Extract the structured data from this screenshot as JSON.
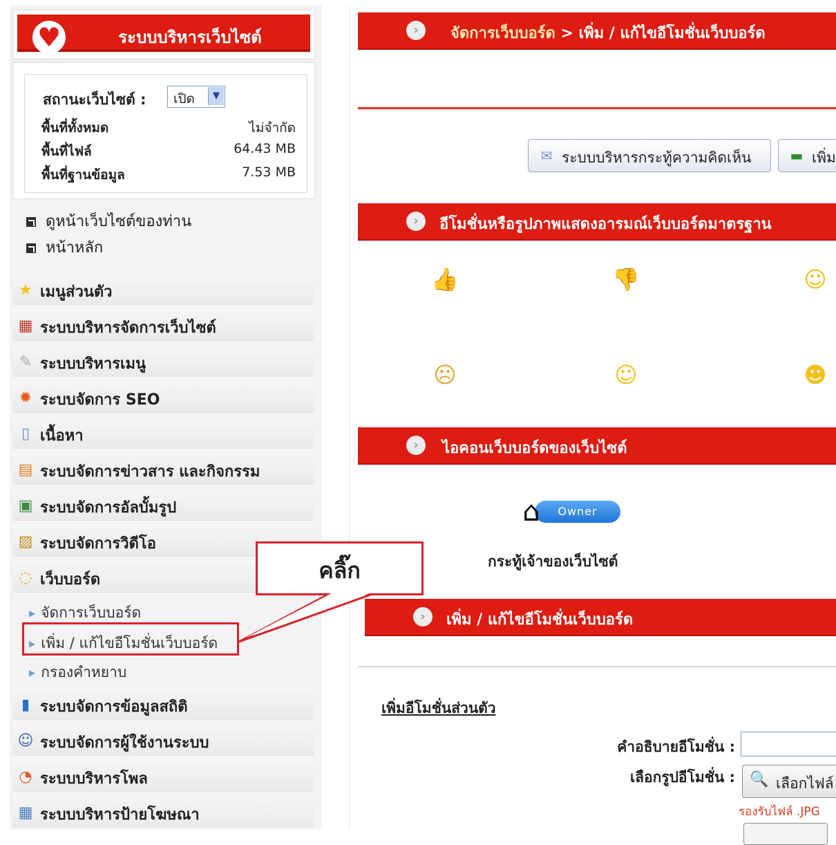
{
  "sidebar": {
    "logo_title": "ระบบบริหารเว็บไซต์",
    "status": {
      "label": "สถานะเว็บไซต์ :",
      "selected": "เปิด",
      "quota": [
        {
          "label": "พื้นที่ทั้งหมด",
          "value": "ไม่จำกัด"
        },
        {
          "label": "พื้นที่ไฟล์",
          "value": "64.43 MB"
        },
        {
          "label": "พื้นที่ฐานข้อมูล",
          "value": "7.53 MB"
        }
      ]
    },
    "links": [
      "ดูหน้าเว็บไซต์ของท่าน",
      "หน้าหลัก"
    ],
    "menu": [
      {
        "label": "เมนูส่วนตัว",
        "icon": "star-icon"
      },
      {
        "label": "ระบบบริหารจัดการเว็บไซต์",
        "icon": "blocks-icon"
      },
      {
        "label": "ระบบบริหารเมนู",
        "icon": "mouse-icon"
      },
      {
        "label": "ระบบจัดการ SEO",
        "icon": "badge-icon"
      },
      {
        "label": "เนื้อหา",
        "icon": "scroll-icon"
      },
      {
        "label": "ระบบจัดการข่าวสาร และกิจกรรม",
        "icon": "news-icon"
      },
      {
        "label": "ระบบจัดการอัลบั้มรูป",
        "icon": "album-icon"
      },
      {
        "label": "ระบบจัดการวิดีโอ",
        "icon": "video-icon"
      },
      {
        "label": "เว็บบอร์ด",
        "icon": "chat-icon"
      }
    ],
    "webboard_sub": [
      "จัดการเว็บบอร์ด",
      "เพิ่ม / แก้ไขอีโมชั่นเว็บบอร์ด",
      "กรองคำหยาบ"
    ],
    "menu_after": [
      {
        "label": "ระบบจัดการข้อมูลสถิติ",
        "icon": "stats-icon"
      },
      {
        "label": "ระบบจัดการผู้ใช้งานระบบ",
        "icon": "user-icon"
      },
      {
        "label": "ระบบบริหารโพล",
        "icon": "pie-icon"
      },
      {
        "label": "ระบบบริหารป้ายโฆษณา",
        "icon": "banner-icon"
      }
    ]
  },
  "main": {
    "breadcrumb_part1": "จัดการเว็บบอร์ด",
    "breadcrumb_sep": " > ",
    "breadcrumb_part2": "เพิ่ม / แก้ไขอีโมชั่นเว็บบอร์ด",
    "toolbar": {
      "comment_admin": "ระบบบริหารกระทู้ความคิดเห็น",
      "add": "เพิ่ม"
    },
    "emotions_title": "อีโมชั่นหรือรูปภาพแสดงอารมณ์เว็บบอร์ดมาตรฐาน",
    "emotions": [
      "thumbs-up-icon",
      "thumbs-down-icon",
      "smile-icon",
      "sad-icon",
      "confused-icon",
      "wave-icon"
    ],
    "icons_title": "ไอคอนเว็บบอร์ดของเว็บไซต์",
    "owner_badge": "Owner",
    "owner_caption": "กระทู้เจ้าของเว็บไซต์",
    "edit_title": "เพิ่ม / แก้ไขอีโมชั่นเว็บบอร์ด",
    "form": {
      "section_title": "เพิ่มอีโมชั่นส่วนตัว",
      "desc_label": "คำอธิบายอีโมชั่น :",
      "desc_value": "",
      "image_label": "เลือกรูปอีโมชั่น :",
      "file_button": "เลือกไฟล์",
      "support_note": "รองรับไฟล์ .JPG"
    }
  },
  "callout": {
    "text": "คลิ๊ก"
  }
}
